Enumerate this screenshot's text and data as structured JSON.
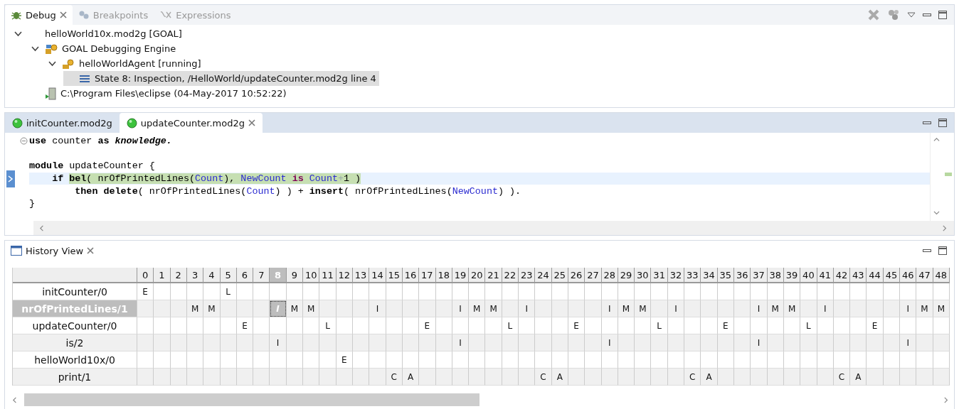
{
  "debug_view": {
    "tabs": [
      {
        "label": "Debug",
        "kind": "debug",
        "selected": true
      },
      {
        "label": "Breakpoints",
        "kind": "breakpoints",
        "selected": false
      },
      {
        "label": "Expressions",
        "kind": "expressions",
        "selected": false
      }
    ],
    "tree": [
      {
        "label": "helloWorld10x.mod2g [GOAL]",
        "kind": "launch",
        "expanded": true,
        "selected": false,
        "children": [
          {
            "label": "GOAL Debugging Engine",
            "kind": "engine",
            "expanded": true,
            "selected": false,
            "children": [
              {
                "label": "helloWorldAgent [running]",
                "kind": "agent",
                "expanded": true,
                "selected": false,
                "children": [
                  {
                    "label": "State 8: Inspection, /HelloWorld/updateCounter.mod2g line 4",
                    "kind": "state",
                    "selected": true
                  }
                ]
              }
            ]
          },
          {
            "label": "C:\\Program Files\\eclipse (04-May-2017 10:52:22)",
            "kind": "process",
            "selected": false
          }
        ]
      }
    ]
  },
  "editor": {
    "tabs": [
      {
        "label": "initCounter.mod2g",
        "selected": false
      },
      {
        "label": "updateCounter.mod2g",
        "selected": true
      }
    ],
    "lines": [
      {
        "foldable": true,
        "current": false,
        "tokens": [
          {
            "text": "use",
            "kind": "kw",
            "highlighted": false
          },
          {
            "text": " counter ",
            "kind": "plain",
            "highlighted": false
          },
          {
            "text": "as ",
            "kind": "kw",
            "highlighted": false
          },
          {
            "text": "knowledge.",
            "kind": "kwit",
            "highlighted": false
          }
        ]
      },
      {
        "foldable": false,
        "current": false
      },
      {
        "foldable": false,
        "current": false,
        "tokens": [
          {
            "text": "module",
            "kind": "kw",
            "highlighted": false
          },
          {
            "text": " updateCounter {",
            "kind": "plain",
            "highlighted": false
          }
        ]
      },
      {
        "foldable": false,
        "current": true,
        "tokens": [
          {
            "text": "    if ",
            "kind": "kw",
            "highlighted": false
          },
          {
            "text": "bel",
            "kind": "kw",
            "highlighted": true
          },
          {
            "text": "( nrOfPrintedLines(",
            "kind": "plain",
            "highlighted": true
          },
          {
            "text": "Count",
            "kind": "var",
            "highlighted": true
          },
          {
            "text": "), ",
            "kind": "plain",
            "highlighted": true
          },
          {
            "text": "NewCount",
            "kind": "var",
            "highlighted": true
          },
          {
            "text": " is ",
            "kind": "op",
            "highlighted": true
          },
          {
            "text": "Count",
            "kind": "var",
            "highlighted": true
          },
          {
            "text": "+",
            "kind": "faint",
            "highlighted": true
          },
          {
            "text": "1 )",
            "kind": "plain",
            "highlighted": true
          }
        ]
      },
      {
        "foldable": false,
        "current": false,
        "tokens": [
          {
            "text": "        then delete",
            "kind": "kw",
            "highlighted": false
          },
          {
            "text": "( nrOfPrintedLines(",
            "kind": "plain",
            "highlighted": false
          },
          {
            "text": "Count",
            "kind": "var",
            "highlighted": false
          },
          {
            "text": ") ) + ",
            "kind": "plain",
            "highlighted": false
          },
          {
            "text": "insert",
            "kind": "kw",
            "highlighted": false
          },
          {
            "text": "( nrOfPrintedLines(",
            "kind": "plain",
            "highlighted": false
          },
          {
            "text": "NewCount",
            "kind": "var",
            "highlighted": false
          },
          {
            "text": ") ).",
            "kind": "plain",
            "highlighted": false
          }
        ]
      },
      {
        "foldable": false,
        "current": false,
        "tokens": [
          {
            "text": "}",
            "kind": "plain",
            "highlighted": false
          }
        ]
      }
    ]
  },
  "history_view": {
    "title": "History View",
    "columns": [
      {
        "label": "0",
        "selected": false
      },
      {
        "label": "1",
        "selected": false
      },
      {
        "label": "2",
        "selected": false
      },
      {
        "label": "3",
        "selected": false
      },
      {
        "label": "4",
        "selected": false
      },
      {
        "label": "5",
        "selected": false
      },
      {
        "label": "6",
        "selected": false
      },
      {
        "label": "7",
        "selected": false
      },
      {
        "label": "8",
        "selected": true
      },
      {
        "label": "9",
        "selected": false
      },
      {
        "label": "10",
        "selected": false
      },
      {
        "label": "11",
        "selected": false
      },
      {
        "label": "12",
        "selected": false
      },
      {
        "label": "13",
        "selected": false
      },
      {
        "label": "14",
        "selected": false
      },
      {
        "label": "15",
        "selected": false
      },
      {
        "label": "16",
        "selected": false
      },
      {
        "label": "17",
        "selected": false
      },
      {
        "label": "18",
        "selected": false
      },
      {
        "label": "19",
        "selected": false
      },
      {
        "label": "20",
        "selected": false
      },
      {
        "label": "21",
        "selected": false
      },
      {
        "label": "22",
        "selected": false
      },
      {
        "label": "23",
        "selected": false
      },
      {
        "label": "24",
        "selected": false
      },
      {
        "label": "25",
        "selected": false
      },
      {
        "label": "26",
        "selected": false
      },
      {
        "label": "27",
        "selected": false
      },
      {
        "label": "28",
        "selected": false
      },
      {
        "label": "29",
        "selected": false
      },
      {
        "label": "30",
        "selected": false
      },
      {
        "label": "31",
        "selected": false
      },
      {
        "label": "32",
        "selected": false
      },
      {
        "label": "33",
        "selected": false
      },
      {
        "label": "34",
        "selected": false
      },
      {
        "label": "35",
        "selected": false
      },
      {
        "label": "36",
        "selected": false
      },
      {
        "label": "37",
        "selected": false
      },
      {
        "label": "38",
        "selected": false
      },
      {
        "label": "39",
        "selected": false
      },
      {
        "label": "40",
        "selected": false
      },
      {
        "label": "41",
        "selected": false
      },
      {
        "label": "42",
        "selected": false
      },
      {
        "label": "43",
        "selected": false
      },
      {
        "label": "44",
        "selected": false
      },
      {
        "label": "45",
        "selected": false
      },
      {
        "label": "46",
        "selected": false
      },
      {
        "label": "47",
        "selected": false
      },
      {
        "label": "48",
        "selected": false
      }
    ],
    "rows": [
      {
        "name": "initCounter/0",
        "selected": false,
        "cells": [
          "E",
          null,
          null,
          null,
          null,
          "L",
          null,
          null,
          null,
          null,
          null,
          null,
          null,
          null,
          null,
          null,
          null,
          null,
          null,
          null,
          null,
          null,
          null,
          null,
          null,
          null,
          null,
          null,
          null,
          null,
          null,
          null,
          null,
          null,
          null,
          null,
          null,
          null,
          null,
          null,
          null,
          null,
          null,
          null,
          null,
          null,
          null,
          null,
          null
        ]
      },
      {
        "name": "nrOfPrintedLines/1",
        "selected": true,
        "cells": [
          null,
          null,
          null,
          "M",
          "M",
          null,
          null,
          null,
          "I",
          "M",
          "M",
          null,
          null,
          null,
          "I",
          null,
          null,
          null,
          null,
          "I",
          "M",
          "M",
          null,
          "I",
          null,
          null,
          null,
          null,
          "I",
          "M",
          "M",
          null,
          "I",
          null,
          null,
          null,
          null,
          "I",
          "M",
          "M",
          null,
          "I",
          null,
          null,
          null,
          null,
          "I",
          "M",
          "M"
        ]
      },
      {
        "name": "updateCounter/0",
        "selected": false,
        "cells": [
          null,
          null,
          null,
          null,
          null,
          null,
          "E",
          null,
          null,
          null,
          null,
          "L",
          null,
          null,
          null,
          null,
          null,
          "E",
          null,
          null,
          null,
          null,
          "L",
          null,
          null,
          null,
          "E",
          null,
          null,
          null,
          null,
          "L",
          null,
          null,
          null,
          "E",
          null,
          null,
          null,
          null,
          "L",
          null,
          null,
          null,
          "E",
          null,
          null,
          null,
          null
        ]
      },
      {
        "name": "is/2",
        "selected": false,
        "cells": [
          null,
          null,
          null,
          null,
          null,
          null,
          null,
          null,
          "I",
          null,
          null,
          null,
          null,
          null,
          null,
          null,
          null,
          null,
          null,
          "I",
          null,
          null,
          null,
          null,
          null,
          null,
          null,
          null,
          "I",
          null,
          null,
          null,
          null,
          null,
          null,
          null,
          null,
          "I",
          null,
          null,
          null,
          null,
          null,
          null,
          null,
          null,
          "I",
          null,
          null
        ]
      },
      {
        "name": "helloWorld10x/0",
        "selected": false,
        "cells": [
          null,
          null,
          null,
          null,
          null,
          null,
          null,
          null,
          null,
          null,
          null,
          null,
          "E",
          null,
          null,
          null,
          null,
          null,
          null,
          null,
          null,
          null,
          null,
          null,
          null,
          null,
          null,
          null,
          null,
          null,
          null,
          null,
          null,
          null,
          null,
          null,
          null,
          null,
          null,
          null,
          null,
          null,
          null,
          null,
          null,
          null,
          null,
          null,
          null
        ]
      },
      {
        "name": "print/1",
        "selected": false,
        "cells": [
          null,
          null,
          null,
          null,
          null,
          null,
          null,
          null,
          null,
          null,
          null,
          null,
          null,
          null,
          null,
          "C",
          "A",
          null,
          null,
          null,
          null,
          null,
          null,
          null,
          "C",
          "A",
          null,
          null,
          null,
          null,
          null,
          null,
          null,
          "C",
          "A",
          null,
          null,
          null,
          null,
          null,
          null,
          null,
          "C",
          "A",
          null,
          null,
          null,
          null,
          null
        ]
      }
    ]
  }
}
